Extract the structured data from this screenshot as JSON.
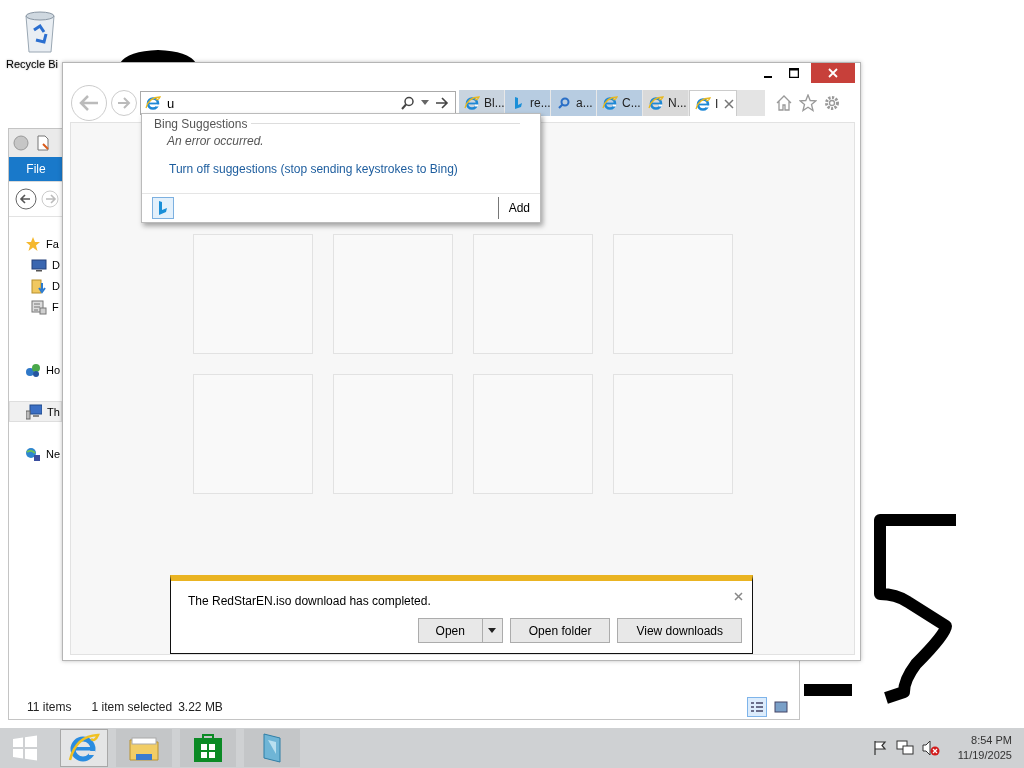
{
  "desktop": {
    "icons": [
      {
        "label": "Recycle Bi",
        "kind": "recycle"
      }
    ]
  },
  "explorer": {
    "ribbon_tabs": [
      {
        "label": "File",
        "selected": true
      }
    ],
    "nav_items": [
      {
        "label": "Fa",
        "kind": "star",
        "selected": false,
        "children": [
          {
            "label": "D",
            "kind": "desktop",
            "selected": false
          },
          {
            "label": "D",
            "kind": "downloads",
            "selected": false
          },
          {
            "label": "F",
            "kind": "recent",
            "selected": false
          }
        ]
      },
      {
        "label": "Ho",
        "kind": "homegroup",
        "selected": false
      },
      {
        "label": "Th",
        "kind": "computer",
        "selected": true
      },
      {
        "label": "Ne",
        "kind": "network",
        "selected": false
      }
    ],
    "status_bar": {
      "item_count": "11 items",
      "selection": "1 item selected",
      "size": "3.22 MB"
    },
    "views": [
      {
        "kind": "details",
        "selected": true
      },
      {
        "kind": "tiles",
        "selected": false
      }
    ]
  },
  "browser": {
    "address": {
      "value": "u"
    },
    "tabs": [
      {
        "label": "Bl...",
        "kind": "ie",
        "selected": false,
        "color": "#c9d4df"
      },
      {
        "label": "re...",
        "kind": "bing",
        "selected": false,
        "color": "#b7cce1"
      },
      {
        "label": "a...",
        "kind": "search",
        "selected": false,
        "color": "#b7cce1"
      },
      {
        "label": "C...",
        "kind": "ie",
        "selected": false,
        "color": "#b7cce1"
      },
      {
        "label": "N...",
        "kind": "ie",
        "selected": false,
        "color": "#d9d9d9"
      },
      {
        "label": "I",
        "kind": "ie",
        "selected": true,
        "color": "#ffffff"
      }
    ],
    "suggestions": {
      "heading": "Bing Suggestions",
      "message": "An error occurred.",
      "link": "Turn off suggestions (stop sending keystrokes to Bing)",
      "add_button": "Add"
    },
    "download": {
      "message": "The RedStarEN.iso download has completed.",
      "buttons": [
        "Open",
        "Open folder",
        "View downloads"
      ]
    }
  },
  "taskbar": {
    "apps": [
      {
        "kind": "ie",
        "selected": true
      },
      {
        "kind": "explorer",
        "selected": false
      },
      {
        "kind": "store",
        "selected": false
      },
      {
        "kind": "app",
        "selected": false
      }
    ],
    "clock": {
      "time": "8:54 PM",
      "date": "11/19/2025"
    }
  }
}
